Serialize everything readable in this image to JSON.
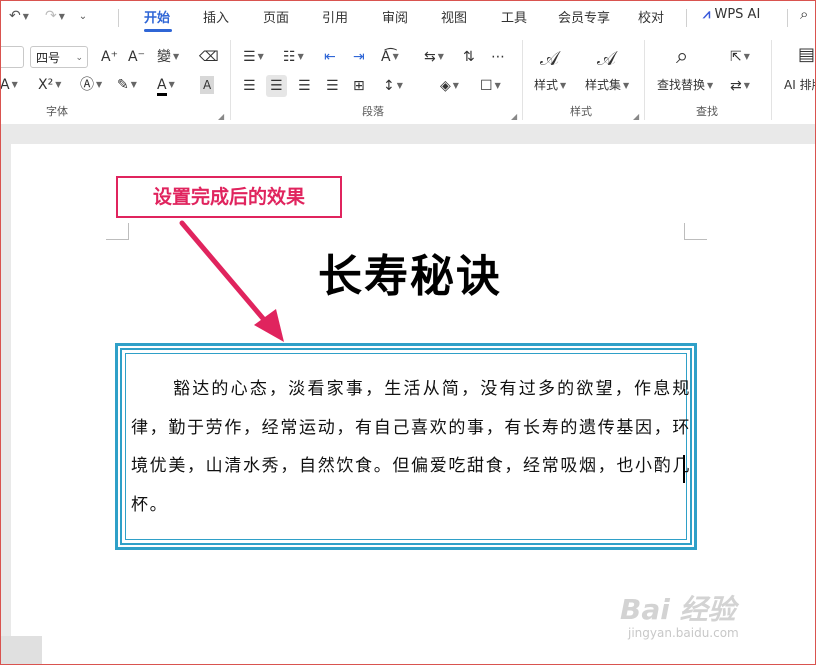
{
  "quick_access": {
    "redo_icon": "redo-icon",
    "undo_icon": "undo-icon",
    "more_icon": "chevron-down-icon"
  },
  "tabs": [
    {
      "label": "开始",
      "active": true
    },
    {
      "label": "插入"
    },
    {
      "label": "页面"
    },
    {
      "label": "引用"
    },
    {
      "label": "审阅"
    },
    {
      "label": "视图"
    },
    {
      "label": "工具"
    },
    {
      "label": "会员专享"
    },
    {
      "label": "校对"
    },
    {
      "label": "WPS AI"
    }
  ],
  "ribbon": {
    "font": {
      "font_size": "四号",
      "group_label": "字体"
    },
    "paragraph": {
      "group_label": "段落"
    },
    "styles": {
      "style_label": "样式",
      "style_set_label": "样式集",
      "group_label": "样式"
    },
    "find": {
      "find_replace_label": "查找替换",
      "group_label": "查找"
    },
    "ai": {
      "label": "AI 排版"
    }
  },
  "document": {
    "title": "长寿秘诀",
    "body": "豁达的心态，淡看家事，生活从简，没有过多的欲望，作息规律，勤于劳作，经常运动，有自己喜欢的事，有长寿的遗传基因，环境优美，山清水秀，自然饮食。但偏爱吃甜食，经常吸烟，也小酌几杯。"
  },
  "annotation": {
    "callout_text": "设置完成后的效果",
    "color": "#e0245e"
  },
  "watermark": {
    "main": "Bai 经验",
    "sub": "jingyan.baidu.com"
  },
  "colors": {
    "accent": "#2f66d6",
    "border": "#2fa0c8"
  }
}
